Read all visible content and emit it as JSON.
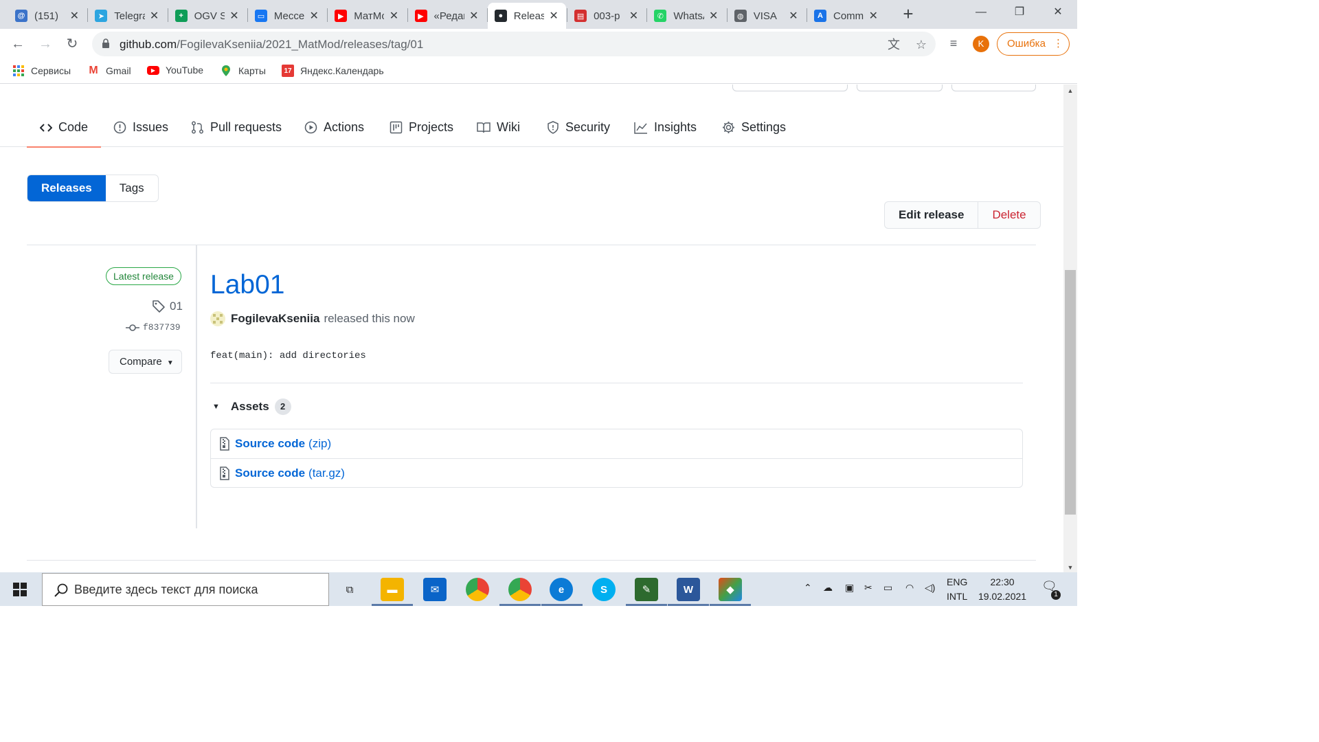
{
  "browser": {
    "tabs": [
      {
        "title": "(151)",
        "icon": "social-icon",
        "color": "#3b73c9",
        "glyph": "@"
      },
      {
        "title": "Telegram",
        "icon": "telegram-icon",
        "color": "#2ca5e0",
        "glyph": "➤"
      },
      {
        "title": "OGV S",
        "icon": "sheets-icon",
        "color": "#0f9d58",
        "glyph": "+"
      },
      {
        "title": "Мессенджер",
        "icon": "messenger-icon",
        "color": "#1877f2",
        "glyph": "▭"
      },
      {
        "title": "МатМод",
        "icon": "youtube-icon",
        "color": "#ff0000",
        "glyph": "▶"
      },
      {
        "title": "«Редакт",
        "icon": "youtube-icon",
        "color": "#ff0000",
        "glyph": "▶"
      },
      {
        "title": "Releases",
        "icon": "github-icon",
        "color": "#24292e",
        "glyph": "●",
        "active": true
      },
      {
        "title": "003-p",
        "icon": "doc-icon",
        "color": "#d32f2f",
        "glyph": "▤"
      },
      {
        "title": "WhatsApp",
        "icon": "whatsapp-icon",
        "color": "#25d366",
        "glyph": "✆"
      },
      {
        "title": "VISA",
        "icon": "globe-icon",
        "color": "#5f6368",
        "glyph": "◍"
      },
      {
        "title": "Comm",
        "icon": "translate-icon",
        "color": "#1a73e8",
        "glyph": "A"
      }
    ],
    "new_tab": "+",
    "url_main": "github.com",
    "url_path": "/FogilevaKseniia/2021_MatMod/releases/tag/01",
    "profile_initial": "K",
    "error_label": "Ошибка"
  },
  "bookmarks": [
    {
      "label": "Сервисы",
      "icon": "apps-icon"
    },
    {
      "label": "Gmail",
      "icon": "gmail-icon"
    },
    {
      "label": "YouTube",
      "icon": "youtube-icon"
    },
    {
      "label": "Карты",
      "icon": "maps-icon"
    },
    {
      "label": "Яндекс.Календарь",
      "icon": "calendar-icon",
      "badge": "17"
    }
  ],
  "repo_nav": [
    {
      "label": "Code",
      "icon": "code-icon",
      "selected": true
    },
    {
      "label": "Issues",
      "icon": "issue-icon"
    },
    {
      "label": "Pull requests",
      "icon": "pull-request-icon"
    },
    {
      "label": "Actions",
      "icon": "play-icon"
    },
    {
      "label": "Projects",
      "icon": "project-icon"
    },
    {
      "label": "Wiki",
      "icon": "book-icon"
    },
    {
      "label": "Security",
      "icon": "shield-icon"
    },
    {
      "label": "Insights",
      "icon": "graph-icon"
    },
    {
      "label": "Settings",
      "icon": "gear-icon"
    }
  ],
  "subnav": {
    "releases": "Releases",
    "tags": "Tags"
  },
  "release_actions": {
    "edit": "Edit release",
    "delete": "Delete"
  },
  "release": {
    "badge": "Latest release",
    "tag": "01",
    "commit": "f837739",
    "compare": "Compare",
    "title": "Lab01",
    "author": "FogilevaKseniia",
    "released_text": "released this now",
    "body": "feat(main): add directories",
    "assets_label": "Assets",
    "assets_count": "2",
    "assets": [
      {
        "name": "Source code",
        "ext": "(zip)"
      },
      {
        "name": "Source code",
        "ext": "(tar.gz)"
      }
    ]
  },
  "taskbar": {
    "search_placeholder": "Введите здесь текст для поиска",
    "lang_top": "ENG",
    "lang_bottom": "INTL",
    "time": "22:30",
    "date": "19.02.2021",
    "notif_count": "1"
  }
}
